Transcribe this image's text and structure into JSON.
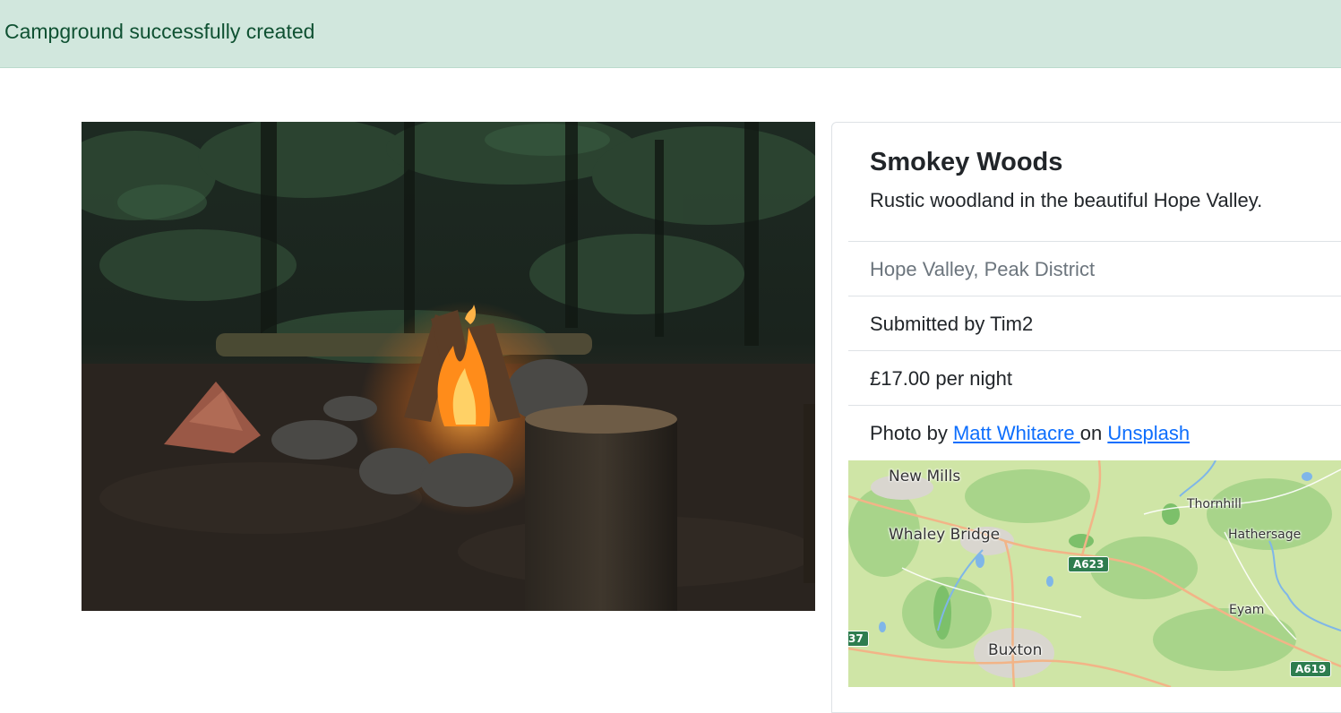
{
  "flash": {
    "message": "Campground successfully created"
  },
  "campground": {
    "title": "Smokey Woods",
    "description": "Rustic woodland in the beautiful Hope Valley.",
    "location": "Hope Valley, Peak District",
    "submitted_by": "Submitted by Tim2",
    "price": "£17.00 per night",
    "photo_credit": {
      "prefix": "Photo by ",
      "author": "Matt Whitacre ",
      "middle": "on ",
      "site": "Unsplash"
    },
    "image_alt": "campfire-in-forest-photo"
  },
  "map": {
    "places": {
      "new_mills": "New Mills",
      "whaley_bridge": "Whaley Bridge",
      "buxton": "Buxton",
      "thornhill": "Thornhill",
      "hathersage": "Hathersage",
      "eyam": "Eyam"
    },
    "roads": {
      "a623": "A623",
      "a619": "A619",
      "a37": "37"
    }
  },
  "colors": {
    "alert_bg": "#d1e7dd",
    "alert_text": "#0f5132",
    "link": "#0d6efd",
    "muted": "#6c757d",
    "map_land": "#cfe5a6",
    "map_shield": "#2e7d4f"
  }
}
